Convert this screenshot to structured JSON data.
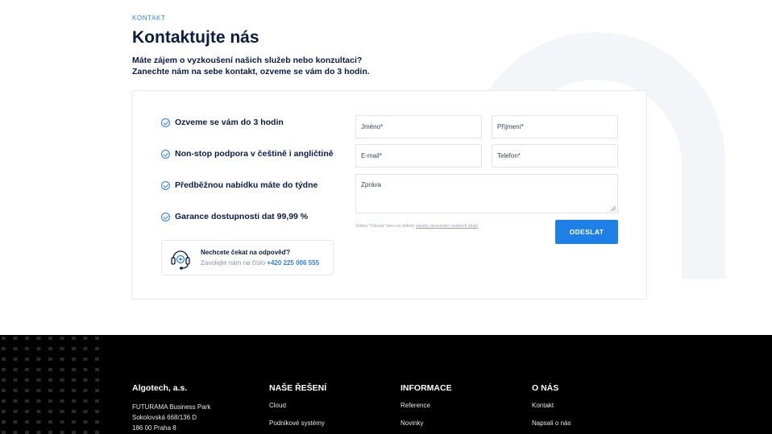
{
  "section_label": "KONTAKT",
  "title": "Kontaktujte nás",
  "intro": {
    "line1": "Máte zájem o vyzkoušení našich služeb nebo konzultaci?",
    "line2": "Zanechte nám na sebe kontakt, ozveme se vám do 3 hodin."
  },
  "benefits": [
    "Ozveme se vám do 3 hodin",
    "Non-stop podpora v češtině i angličtině",
    "Předběžnou nabídku máte do týdne",
    "Garance dostupnosti dat 99,99 %"
  ],
  "callbox": {
    "question": "Nechcete čekat na odpověď?",
    "prefix": "Zavolejte nám na číslo",
    "phone": "+420 225 006 555"
  },
  "form": {
    "name_placeholder": "Jméno*",
    "surname_placeholder": "Příjmení*",
    "email_placeholder": "E-mail*",
    "phone_placeholder": "Telefon*",
    "message_placeholder": "Zpráva",
    "consent_text": "Volbou \"Odeslat\" beru na vědomí",
    "consent_link": "zásady zpracování osobních údajů",
    "submit_label": "ODESLAT"
  },
  "footer": {
    "company": {
      "name": "Algotech, a.s.",
      "address": [
        "FUTURAMA Business Park",
        "Sokolovská 668/136 D",
        "186 00 Praha 8"
      ]
    },
    "solutions": {
      "heading": "NAŠE ŘEŠENÍ",
      "links": [
        "Cloud",
        "Podnikové systémy"
      ]
    },
    "info": {
      "heading": "INFORMACE",
      "links": [
        "Reference",
        "Novinky"
      ]
    },
    "about": {
      "heading": "O NÁS",
      "links": [
        "Kontakt",
        "Napsali o nás"
      ]
    }
  },
  "colors": {
    "accent": "#1e7fe6",
    "heading": "#0c1b43",
    "footer_bg": "#000000"
  }
}
